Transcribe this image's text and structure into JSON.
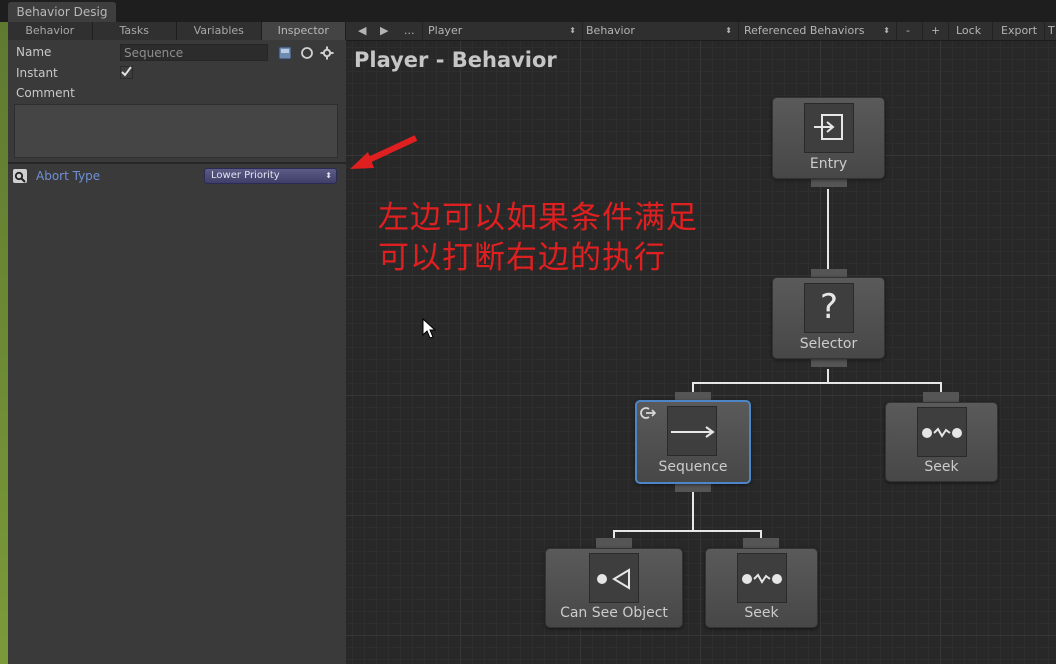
{
  "window": {
    "tab_label": "Behavior Desig"
  },
  "panel": {
    "tabs": [
      "Behavior",
      "Tasks",
      "Variables",
      "Inspector"
    ],
    "active_tab": "Inspector",
    "name_label": "Name",
    "name_value": "Sequence",
    "instant_label": "Instant",
    "instant_checked": true,
    "comment_label": "Comment",
    "abort_type_label": "Abort Type",
    "abort_type_value": "Lower Priority"
  },
  "toolbar": {
    "prev": "◀",
    "next": "▶",
    "more": "...",
    "object_dropdown": "Player",
    "behavior_dropdown": "Behavior",
    "referenced_dropdown": "Referenced Behaviors",
    "minus": "-",
    "plus": "+",
    "lock": "Lock",
    "export": "Export",
    "overflow": "T"
  },
  "graph": {
    "title": "Player - Behavior",
    "nodes": {
      "entry": "Entry",
      "selector": "Selector",
      "sequence": "Sequence",
      "seek_right": "Seek",
      "can_see_object": "Can See Object",
      "seek_bottom": "Seek"
    },
    "selector_glyph": "?"
  },
  "annotation": {
    "line1": "左边可以如果条件满足",
    "line2": "可以打断右边的执行",
    "color": "#e02020"
  },
  "colors": {
    "selection": "#4d86c6",
    "abort_label": "#6f8fd6",
    "panel_bg": "#3a3a3a",
    "canvas_bg": "#282828"
  }
}
